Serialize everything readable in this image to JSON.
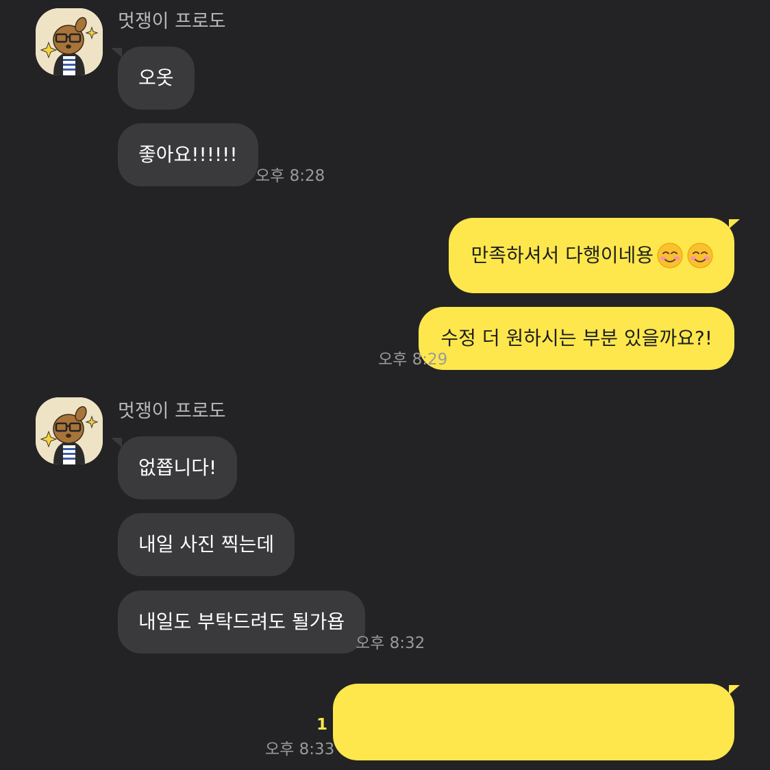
{
  "colors": {
    "background": "#232325",
    "incoming_bubble": "#3a3a3d",
    "outgoing_bubble": "#fde74c",
    "unread_badge": "#fde74c"
  },
  "groups": [
    {
      "sender": "멋쟁이 프로도",
      "avatar_icon": "frodo-character-avatar",
      "messages": [
        "오옷",
        "좋아요!!!!!!"
      ],
      "time": "오후 8:28"
    },
    {
      "direction": "outgoing",
      "messages": [
        "만족하셔서 다행이네용",
        "수정 더 원하시는 부분 있을까요?!"
      ],
      "emoji": [
        "smiling-face-emoji",
        "smiling-face-emoji"
      ],
      "time": "오후 8:29"
    },
    {
      "sender": "멋쟁이 프로도",
      "avatar_icon": "frodo-character-avatar",
      "messages": [
        "없쬽니다!",
        "내일 사진 찍는데",
        "내일도 부탁드려도 될가욥"
      ],
      "time": "오후 8:32"
    },
    {
      "direction": "outgoing",
      "messages": [
        ""
      ],
      "unread_count": "1",
      "time": "오후 8:33"
    }
  ]
}
